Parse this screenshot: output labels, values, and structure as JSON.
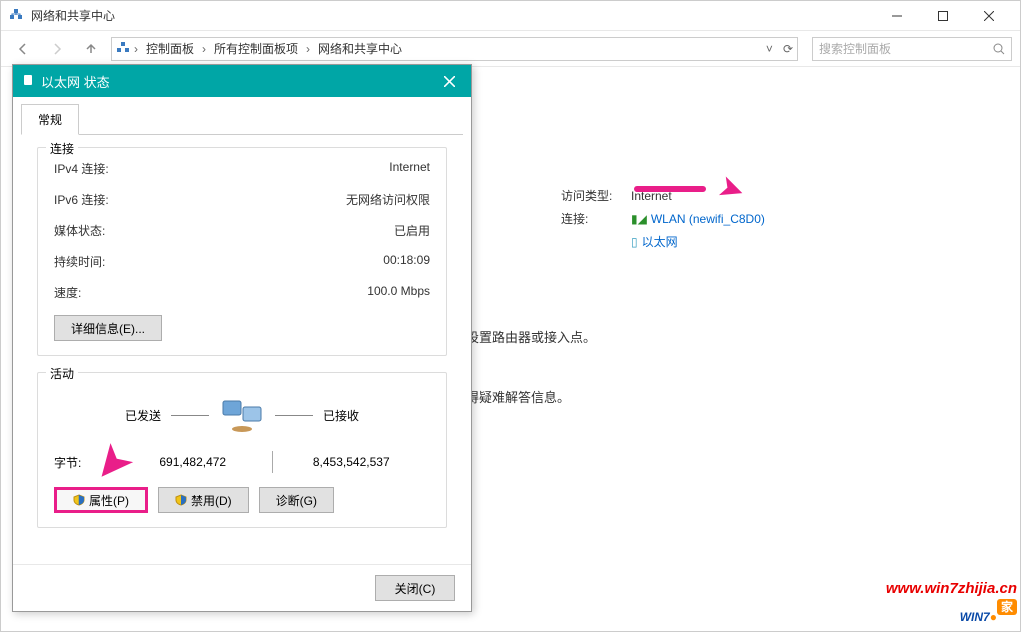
{
  "main": {
    "title": "网络和共享中心",
    "breadcrumb": [
      "控制面板",
      "所有控制面板项",
      "网络和共享中心"
    ],
    "search_placeholder": "搜索控制面板"
  },
  "info": {
    "access_type_label": "访问类型:",
    "access_type_value": "Internet",
    "conn_label": "连接:",
    "wlan_link": "WLAN (newifi_C8D0)",
    "eth_link": "以太网",
    "snippet1": "或设置路由器或接入点。",
    "snippet2": "获得疑难解答信息。"
  },
  "dialog": {
    "title": "以太网 状态",
    "tab": "常规",
    "group_connection": "连接",
    "rows": {
      "ipv4_label": "IPv4 连接:",
      "ipv4_value": "Internet",
      "ipv6_label": "IPv6 连接:",
      "ipv6_value": "无网络访问权限",
      "media_label": "媒体状态:",
      "media_value": "已启用",
      "duration_label": "持续时间:",
      "duration_value": "00:18:09",
      "speed_label": "速度:",
      "speed_value": "100.0 Mbps"
    },
    "details_btn": "详细信息(E)...",
    "group_activity": "活动",
    "sent_label": "已发送",
    "recv_label": "已接收",
    "bytes_label": "字节:",
    "bytes_sent": "691,482,472",
    "bytes_recv": "8,453,542,537",
    "props_btn": "属性(P)",
    "disable_btn": "禁用(D)",
    "diag_btn": "诊断(G)",
    "close_btn": "关闭(C)"
  },
  "watermark": {
    "url": "www.win7zhijia.cn",
    "brand": "WIN7",
    "tag": "家"
  }
}
